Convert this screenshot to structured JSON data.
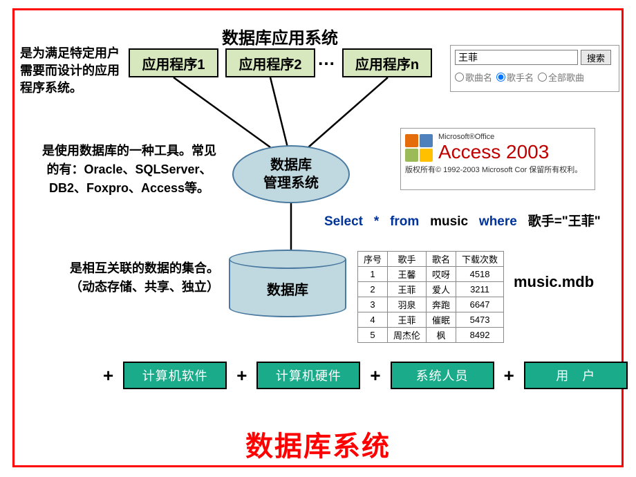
{
  "title_app_system": "数据库应用系统",
  "apps": {
    "a1": "应用程序1",
    "a2": "应用程序2",
    "an": "应用程序n",
    "dots": "…"
  },
  "desc_app": "是为满足特定用户需要而设计的应用程序系统。",
  "search": {
    "value": "王菲",
    "button": "搜索",
    "opt1": "歌曲名",
    "opt2": "歌手名",
    "opt3": "全部歌曲"
  },
  "desc_dbms": "是使用数据库的一种工具。常见的有：Oracle、SQLServer、DB2、Foxpro、Access等。",
  "dbms_label1": "数据库",
  "dbms_label2": "管理系统",
  "access": {
    "ms": "Microsoft®Office",
    "name": "Access 2003",
    "copy": "版权所有© 1992-2003 Microsoft Cor 保留所有权利。"
  },
  "sql": {
    "select": "Select",
    "star": "*",
    "from": "from",
    "table": "music",
    "where": "where",
    "cond": "歌手=\"王菲\""
  },
  "desc_db": "是相互关联的数据的集合。（动态存储、共享、独立）",
  "db_label": "数据库",
  "table_headers": {
    "c1": "序号",
    "c2": "歌手",
    "c3": "歌名",
    "c4": "下载次数"
  },
  "chart_data": {
    "type": "table",
    "columns": [
      "序号",
      "歌手",
      "歌名",
      "下载次数"
    ],
    "rows": [
      {
        "序号": "1",
        "歌手": "王馨",
        "歌名": "哎呀",
        "下载次数": "4518"
      },
      {
        "序号": "2",
        "歌手": "王菲",
        "歌名": "爱人",
        "下载次数": "3211"
      },
      {
        "序号": "3",
        "歌手": "羽泉",
        "歌名": "奔跑",
        "下载次数": "6647"
      },
      {
        "序号": "4",
        "歌手": "王菲",
        "歌名": "催眠",
        "下载次数": "5473"
      },
      {
        "序号": "5",
        "歌手": "周杰伦",
        "歌名": "枫",
        "下载次数": "8492"
      }
    ]
  },
  "mdb": "music.mdb",
  "plus": "+",
  "components": {
    "b1": "计算机软件",
    "b2": "计算机硬件",
    "b3": "系统人员",
    "b4": "用　户"
  },
  "system_title": "数据库系统"
}
